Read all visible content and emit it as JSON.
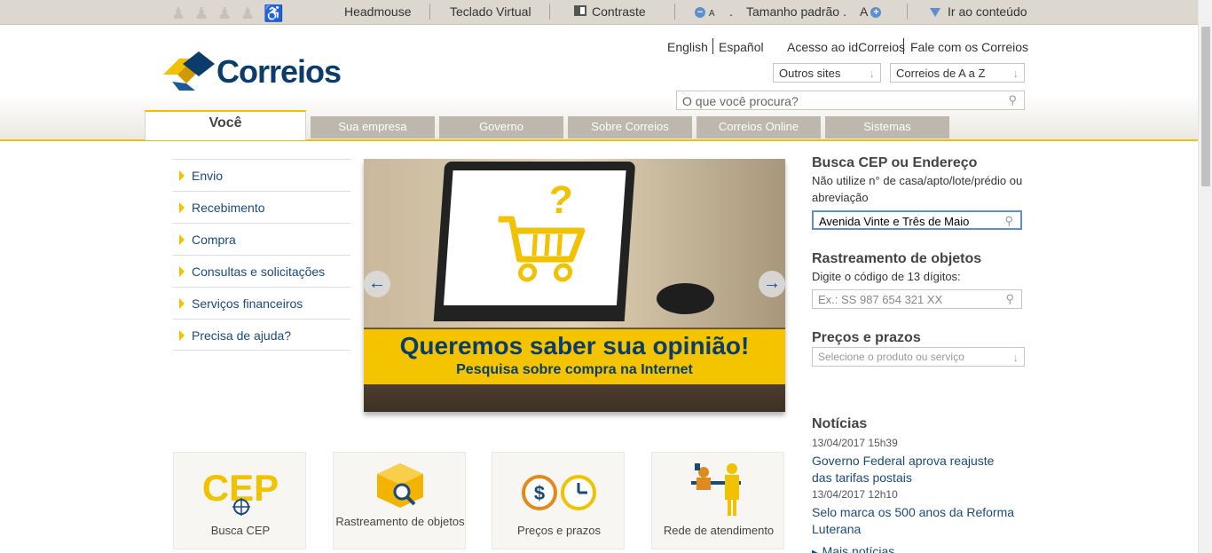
{
  "accessibility_bar": {
    "headmouse": "Headmouse",
    "teclado_virtual": "Teclado Virtual",
    "contraste": "Contraste",
    "font_small": "A",
    "tamanho_padrao": "Tamanho padrão",
    "font_large": "A",
    "ir_ao_conteudo": "Ir ao conteúdo",
    "dot1": ".",
    "dot2": "."
  },
  "header": {
    "logo_text": "Correios",
    "lang_english": "English",
    "lang_espanol": "Español",
    "acesso": "Acesso ao idCorreios",
    "fale": "Fale com os Correios",
    "outros_sites": "Outros sites",
    "correios_az": "Correios de A a Z",
    "search_placeholder": "O que você procura?"
  },
  "tabs": {
    "active": "Você",
    "items": [
      "Sua empresa",
      "Governo",
      "Sobre Correios",
      "Correios Online",
      "Sistemas"
    ]
  },
  "left_menu": [
    "Envio",
    "Recebimento",
    "Compra",
    "Consultas e solicitações",
    "Serviços financeiros",
    "Precisa de ajuda?"
  ],
  "banner": {
    "question_mark": "?",
    "title": "Queremos saber sua opinião!",
    "subtitle": "Pesquisa sobre compra na Internet",
    "prev": "←",
    "next": "→"
  },
  "busca_cep": {
    "title": "Busca CEP ou Endereço",
    "hint": "Não utilize n° de casa/apto/lote/prédio ou abreviação",
    "value": "Avenida Vinte e Três de Maio"
  },
  "rastreamento": {
    "title": "Rastreamento de objetos",
    "hint": "Digite o código de 13 dígitos:",
    "placeholder": "Ex.: SS 987 654 321 XX"
  },
  "precos": {
    "title": "Preços e prazos",
    "select": "Selecione o produto ou serviço"
  },
  "noticias": {
    "title": "Notícias",
    "items": [
      {
        "date": "13/04/2017 15h39",
        "text": "Governo Federal aprova reajuste das tarifas postais"
      },
      {
        "date": "13/04/2017 12h10",
        "text": "Selo marca os 500 anos da Reforma Luterana"
      }
    ],
    "more": "Mais notícias"
  },
  "shortcuts": {
    "cep_glyph": "CEP",
    "items": [
      "Busca CEP",
      "Rastreamento de objetos",
      "Preços e prazos",
      "Rede de atendimento"
    ]
  },
  "colors": {
    "brand_yellow": "#f2c200",
    "brand_blue": "#0a3c6c",
    "link_blue": "#1a4a7a"
  }
}
